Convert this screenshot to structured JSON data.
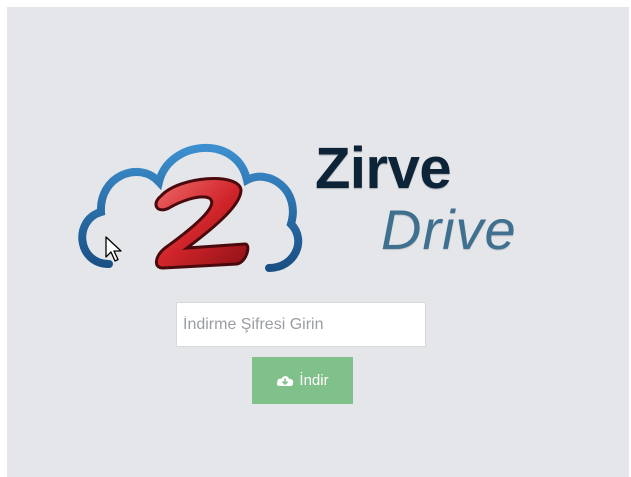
{
  "logo": {
    "word1": "Zirve",
    "word2": "Drive",
    "letter": "Z"
  },
  "form": {
    "password_placeholder": "İndirme Şifresi Girin",
    "download_label": "İndir",
    "download_icon": "cloud-download-icon"
  },
  "colors": {
    "background": "#e4e6ea",
    "button": "#80c08a",
    "logo_dark": "#0d2438",
    "logo_blue": "#3f7090",
    "cloud_blue": "#2a6fae",
    "logo_red": "#d0252a"
  }
}
